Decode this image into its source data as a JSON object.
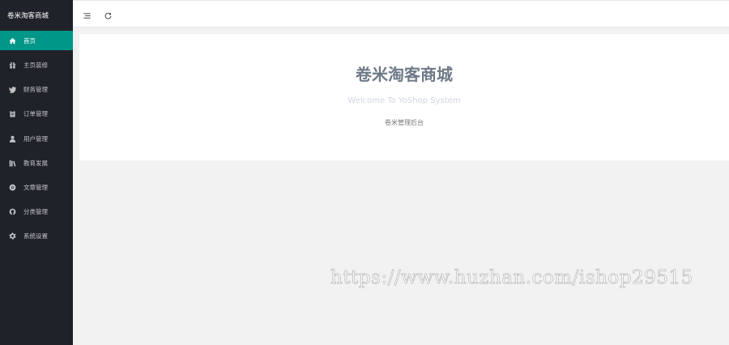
{
  "sidebar": {
    "brand": "卷米淘客商城",
    "items": [
      {
        "label": "首页",
        "icon": "home-icon",
        "active": true
      },
      {
        "label": "主页装修",
        "icon": "gift-icon",
        "active": false
      },
      {
        "label": "财务管理",
        "icon": "twitter-icon",
        "active": false
      },
      {
        "label": "订单管理",
        "icon": "clipboard-icon",
        "active": false
      },
      {
        "label": "用户管理",
        "icon": "user-icon",
        "active": false
      },
      {
        "label": "教育发展",
        "icon": "books-icon",
        "active": false
      },
      {
        "label": "文章管理",
        "icon": "chrome-icon",
        "active": false
      },
      {
        "label": "分类管理",
        "icon": "github-icon",
        "active": false
      },
      {
        "label": "系统设置",
        "icon": "gear-icon",
        "active": false
      }
    ]
  },
  "toolbar": {
    "menu_icon": "menu-toggle-icon",
    "refresh_icon": "refresh-icon"
  },
  "welcome": {
    "title": "卷米淘客商城",
    "subtitle": "Welcome To YoShop System",
    "description": "卷米管理后台"
  },
  "watermark": "https://www.huzhan.com/ishop29515",
  "colors": {
    "sidebar_bg": "#20222a",
    "active_bg": "#009688",
    "page_bg": "#f2f2f2"
  }
}
